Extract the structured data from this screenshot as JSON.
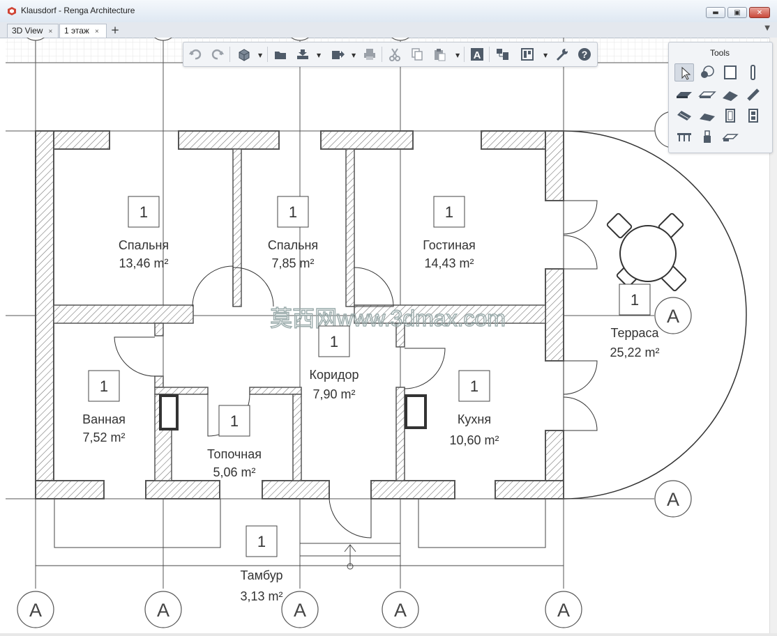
{
  "window": {
    "title": "Klausdorf - Renga Architecture",
    "minimize": "▬",
    "maximize": "▣",
    "close": "✕"
  },
  "tabs": [
    {
      "label": "3D View",
      "close": "×"
    },
    {
      "label": "1 этаж",
      "close": "×"
    }
  ],
  "tab_add": "+",
  "tab_menu": "▼",
  "toolbar": {
    "items": [
      "undo-icon",
      "redo-icon",
      "3d-view-icon",
      "open-folder-icon",
      "import-icon",
      "export-icon",
      "print-icon",
      "cut-icon",
      "copy-icon",
      "paste-icon",
      "text-style-icon",
      "layers-icon",
      "visibility-icon",
      "settings-wrench-icon",
      "help-icon"
    ],
    "help_label": "?",
    "text_label": "A"
  },
  "tools": {
    "title": "Tools",
    "items": [
      "select-icon",
      "axis-icon",
      "wall-icon",
      "column-icon",
      "floor-icon",
      "slab-icon",
      "roof-icon",
      "beam-icon",
      "stair-icon",
      "ramp-icon",
      "window-icon",
      "door-icon",
      "railing-icon",
      "equipment-icon",
      "opening-icon"
    ]
  },
  "plan": {
    "axis_label": "A",
    "rooms": [
      {
        "number": "1",
        "name": "Спальня",
        "area": "13,46 m²"
      },
      {
        "number": "1",
        "name": "Спальня",
        "area": "7,85 m²"
      },
      {
        "number": "1",
        "name": "Гостиная",
        "area": "14,43 m²"
      },
      {
        "number": "1",
        "name": "Терраса",
        "area": "25,22 m²"
      },
      {
        "number": "1",
        "name": "Коридор",
        "area": "7,90 m²"
      },
      {
        "number": "1",
        "name": "Ванная",
        "area": "7,52 m²"
      },
      {
        "number": "1",
        "name": "Топочная",
        "area": "5,06 m²"
      },
      {
        "number": "1",
        "name": "Кухня",
        "area": "10,60 m²"
      },
      {
        "number": "1",
        "name": "Тамбур",
        "area": "3,13 m²"
      }
    ],
    "watermark": "莫西网www.3dmax.com"
  }
}
